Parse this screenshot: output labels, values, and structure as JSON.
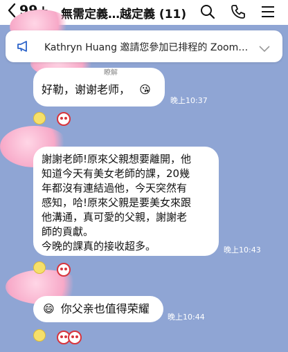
{
  "header": {
    "back_count": "99+",
    "title": "無需定義…越定義 (11)",
    "icons": [
      "back-chevron-icon",
      "search-icon",
      "phone-icon",
      "menu-icon"
    ]
  },
  "notice": {
    "icon": "megaphone-icon",
    "text": "Kathryn Huang 邀請您參加已排程的 Zoom…"
  },
  "messages": [
    {
      "partial_text": "瞭解",
      "text": "好勒，谢谢老师，",
      "emoji": "😘",
      "time": "晚上10:37"
    },
    {
      "text_lines": [
        "謝謝老師!原來父親想要離開，他",
        "知道今天有美女老師的課，20幾",
        "年都沒有連結過他，今天突然有",
        "感知，哈!原來父親是要美女來跟",
        "他溝通，真可愛的父親，謝謝老",
        "師的貢獻。",
        "今晚的課真的接收超多。"
      ],
      "time": "晚上10:43"
    },
    {
      "emoji": "😄",
      "text": "你父亲也值得荣耀",
      "time": "晚上10:44"
    }
  ],
  "colors": {
    "background": "#8fa5d4",
    "bubble": "#ffffff",
    "time": "#ffffff"
  }
}
